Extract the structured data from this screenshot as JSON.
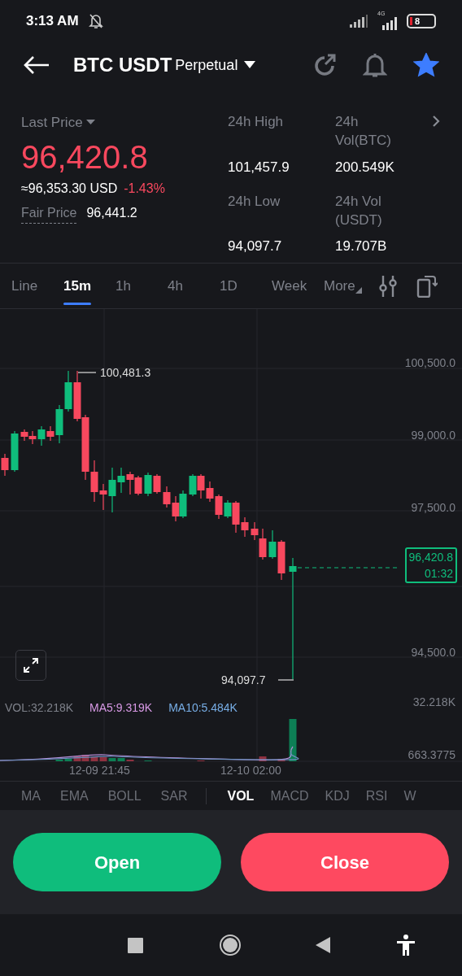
{
  "status_bar": {
    "time": "3:13 AM",
    "battery": "8",
    "network": "4G"
  },
  "header": {
    "title": "BTC USDT",
    "subtitle": "Perpetual",
    "favorite": true
  },
  "summary": {
    "last_price_label": "Last Price",
    "price": "96,420.8",
    "usd": "≈96,353.30 USD",
    "change": "-1.43%",
    "fair_price_label": "Fair Price",
    "fair_price": "96,441.2",
    "stats": [
      {
        "label": "24h High",
        "value": "101,457.9"
      },
      {
        "label": "24h Vol(BTC)",
        "value": "200.549K"
      },
      {
        "label": "24h Low",
        "value": "94,097.7"
      },
      {
        "label": "24h Vol (USDT)",
        "value": "19.707B"
      }
    ]
  },
  "timeframes": [
    {
      "label": "Line",
      "selected": false
    },
    {
      "label": "15m",
      "selected": true
    },
    {
      "label": "1h",
      "selected": false
    },
    {
      "label": "4h",
      "selected": false
    },
    {
      "label": "1D",
      "selected": false
    },
    {
      "label": "Week",
      "selected": false
    },
    {
      "label": "More",
      "selected": false
    }
  ],
  "chart": {
    "price_labels": [
      "100,500.0",
      "99,000.0",
      "97,500.0",
      "94,500.0"
    ],
    "high_marker": "100,481.3",
    "low_marker": "94,097.7",
    "current_price": "96,420.8",
    "countdown": "01:32",
    "volume": {
      "vol": "VOL:32.218K",
      "ma5": "MA5:9.319K",
      "ma10": "MA10:5.484K",
      "axis_labels": [
        "32.218K",
        "663.3775"
      ]
    },
    "time_labels": [
      "12-09 21:45",
      "12-10 02:00"
    ]
  },
  "indicators": {
    "main": [
      {
        "label": "MA",
        "selected": false
      },
      {
        "label": "EMA",
        "selected": false
      },
      {
        "label": "BOLL",
        "selected": false
      },
      {
        "label": "SAR",
        "selected": false
      }
    ],
    "sub": [
      {
        "label": "VOL",
        "selected": true
      },
      {
        "label": "MACD",
        "selected": false
      },
      {
        "label": "KDJ",
        "selected": false
      },
      {
        "label": "RSI",
        "selected": false
      },
      {
        "label": "W",
        "selected": false
      }
    ]
  },
  "actions": [
    {
      "label": "Open",
      "kind": "buy"
    },
    {
      "label": "Close",
      "kind": "sell"
    }
  ]
}
